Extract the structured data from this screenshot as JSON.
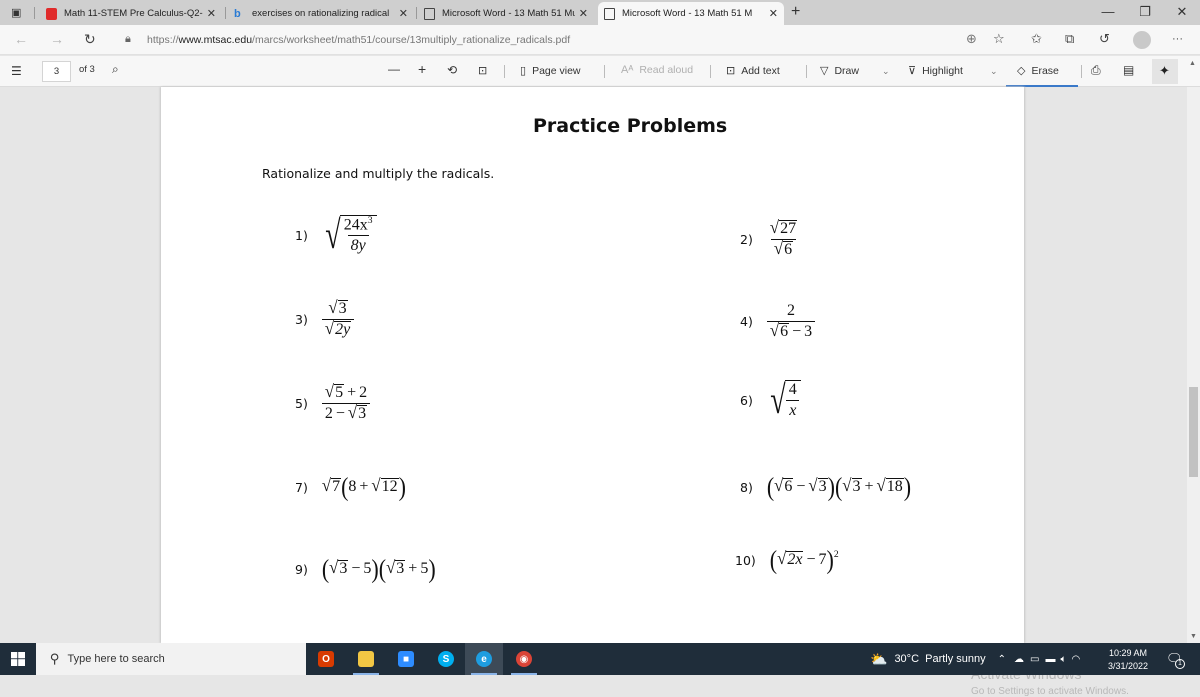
{
  "browser": {
    "tabs": [
      {
        "label": "Math 11-STEM Pre Calculus-Q2-",
        "icon": "pdf-icon",
        "active": false
      },
      {
        "label": "exercises on rationalizing radical",
        "icon": "bing-icon",
        "active": false
      },
      {
        "label": "Microsoft Word - 13 Math 51 Mu",
        "icon": "document-icon",
        "active": false
      },
      {
        "label": "Microsoft Word - 13 Math 51 M",
        "icon": "document-icon",
        "active": true
      }
    ],
    "new_tab": "+",
    "close_glyph": "✕",
    "window_controls": {
      "minimize": "—",
      "restore": "❐",
      "close": "✕"
    },
    "url_prefix": "https://",
    "url_domain": "www.mtsac.edu",
    "url_path": "/marcs/worksheet/math51/course/13multiply_rationalize_radicals.pdf",
    "more_glyph": "···"
  },
  "pdf_toolbar": {
    "current_page": "3",
    "page_total": "of 3",
    "zoom_out": "—",
    "zoom_in": "+",
    "page_view": "Page view",
    "read_aloud": "Read aloud",
    "add_text": "Add text",
    "draw": "Draw",
    "highlight": "Highlight",
    "erase": "Erase",
    "active_tool": "Erase"
  },
  "document": {
    "title": "Practice Problems",
    "instructions": "Rationalize and multiply the radicals.",
    "problems": [
      {
        "n": "1)",
        "latex": "\\sqrt{\\frac{24x^3}{8y}}",
        "parts": {
          "num": "24x",
          "exp": "3",
          "den": "8y"
        }
      },
      {
        "n": "2)",
        "latex": "\\frac{\\sqrt{27}}{\\sqrt{6}}",
        "parts": {
          "num": "27",
          "den": "6"
        }
      },
      {
        "n": "3)",
        "latex": "\\frac{\\sqrt{3}}{\\sqrt{2y}}",
        "parts": {
          "num": "3",
          "den": "2y"
        }
      },
      {
        "n": "4)",
        "latex": "\\frac{2}{\\sqrt{6}-3}",
        "parts": {
          "num": "2",
          "den_rad": "6",
          "den_rest": "3"
        }
      },
      {
        "n": "5)",
        "latex": "\\frac{\\sqrt{5}+2}{2-\\sqrt{3}}",
        "parts": {
          "num_rad": "5",
          "num_rest": "2",
          "den_first": "2",
          "den_rad": "3"
        }
      },
      {
        "n": "6)",
        "latex": "\\sqrt{\\frac{4}{x}}",
        "parts": {
          "num": "4",
          "den": "x"
        }
      },
      {
        "n": "7)",
        "latex": "\\sqrt{7}(8+\\sqrt{12})",
        "parts": {
          "a": "7",
          "b": "8",
          "c": "12"
        }
      },
      {
        "n": "8)",
        "latex": "(\\sqrt{6}-\\sqrt{3})(\\sqrt{3}+\\sqrt{18})",
        "parts": {
          "a": "6",
          "b": "3",
          "c": "3",
          "d": "18"
        }
      },
      {
        "n": "9)",
        "latex": "(\\sqrt{3}-5)(\\sqrt{3}+5)",
        "parts": {
          "a": "3",
          "b": "5",
          "c": "3",
          "d": "5"
        }
      },
      {
        "n": "10)",
        "latex": "(\\sqrt{2x}-7)^2",
        "parts": {
          "a": "2x",
          "b": "7",
          "exp": "2"
        }
      }
    ],
    "symbols": {
      "minus": "−",
      "plus": "+",
      "sqrt": "√"
    }
  },
  "scrollbar": {
    "position_fraction": 0.65
  },
  "watermark": {
    "line1": "Activate Windows",
    "line2": "Go to Settings to activate Windows."
  },
  "taskbar": {
    "search_placeholder": "Type here to search",
    "apps": [
      {
        "name": "office",
        "glyph": "O",
        "color": "#d83b01"
      },
      {
        "name": "file-explorer",
        "glyph": "",
        "color": "#f2c744"
      },
      {
        "name": "zoom",
        "glyph": "■",
        "color": "#2d8cff"
      },
      {
        "name": "skype",
        "glyph": "S",
        "color": "#00aff0"
      },
      {
        "name": "edge",
        "glyph": "e",
        "color": "#1e9de0"
      },
      {
        "name": "chrome",
        "glyph": "◉",
        "color": "#db4437"
      }
    ],
    "weather": "30°C  Partly sunny",
    "time": "10:29 AM",
    "date": "3/31/2022",
    "notifications": "1"
  }
}
